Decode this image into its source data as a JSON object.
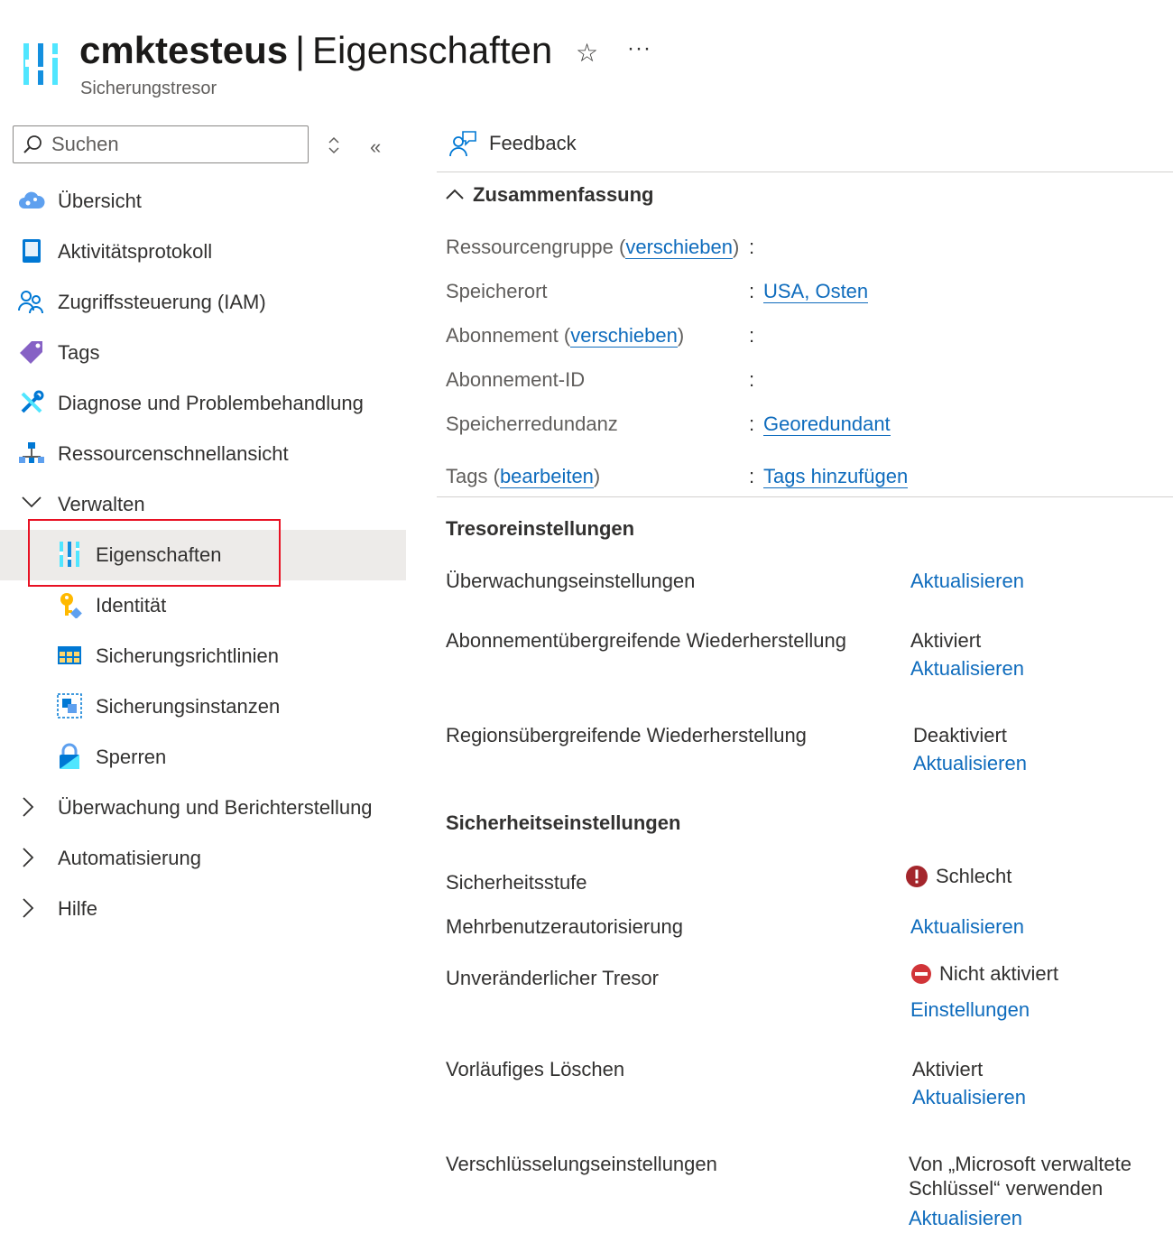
{
  "header": {
    "resource_name": "cmktesteus",
    "separator": "|",
    "page_title": "Eigenschaften",
    "subtitle": "Sicherungstresor",
    "favorite_icon": "star-icon",
    "more_label": "···"
  },
  "sidebar": {
    "search_placeholder": "Suchen",
    "items": [
      {
        "label": "Übersicht",
        "icon": "cloud-overview-icon"
      },
      {
        "label": "Aktivitätsprotokoll",
        "icon": "activity-log-icon"
      },
      {
        "label": "Zugriffssteuerung (IAM)",
        "icon": "people-icon"
      },
      {
        "label": "Tags",
        "icon": "tag-icon"
      },
      {
        "label": "Diagnose und Problembehandlung",
        "icon": "wrench-icon"
      },
      {
        "label": "Ressourcenschnellansicht",
        "icon": "hierarchy-icon"
      },
      {
        "label": "Verwalten",
        "expanded": true
      },
      {
        "label": "Eigenschaften",
        "icon": "properties-icon",
        "selected": true
      },
      {
        "label": "Identität",
        "icon": "key-icon"
      },
      {
        "label": "Sicherungsrichtlinien",
        "icon": "table-icon"
      },
      {
        "label": "Sicherungsinstanzen",
        "icon": "instances-icon"
      },
      {
        "label": "Sperren",
        "icon": "lock-icon"
      },
      {
        "label": "Überwachung und Berichterstellung",
        "expanded": false
      },
      {
        "label": "Automatisierung",
        "expanded": false
      },
      {
        "label": "Hilfe",
        "expanded": false
      }
    ]
  },
  "toolbar": {
    "feedback_label": "Feedback"
  },
  "summary": {
    "title": "Zusammenfassung",
    "rows": {
      "resource_group": {
        "label": "Ressourcengruppe",
        "action": "verschieben",
        "value": ""
      },
      "location": {
        "label": "Speicherort",
        "value": "USA, Osten"
      },
      "subscription": {
        "label": "Abonnement",
        "action": "verschieben",
        "value": ""
      },
      "subscription_id": {
        "label": "Abonnement-ID",
        "value": ""
      },
      "redundancy": {
        "label": "Speicherredundanz",
        "value": "Georedundant"
      },
      "tags": {
        "label": "Tags",
        "action": "bearbeiten",
        "value": "Tags hinzufügen"
      }
    }
  },
  "vault_settings": {
    "title": "Tresoreinstellungen",
    "monitoring": {
      "label": "Überwachungseinstellungen",
      "action": "Aktualisieren"
    },
    "cross_sub_restore": {
      "label": "Abonnementübergreifende Wiederherstellung",
      "status": "Aktiviert",
      "action": "Aktualisieren"
    },
    "cross_region_restore": {
      "label": "Regionsübergreifende Wiederherstellung",
      "status": "Deaktiviert",
      "action": "Aktualisieren"
    }
  },
  "security_settings": {
    "title": "Sicherheitseinstellungen",
    "security_level": {
      "label": "Sicherheitsstufe",
      "status": "Schlecht",
      "status_color": "#a4262c"
    },
    "mua": {
      "label": "Mehrbenutzerautorisierung",
      "action": "Aktualisieren"
    },
    "immutable": {
      "label": "Unveränderlicher Tresor",
      "status": "Nicht aktiviert",
      "status_color": "#d13438",
      "action": "Einstellungen"
    },
    "soft_delete": {
      "label": "Vorläufiges Löschen",
      "status": "Aktiviert",
      "action": "Aktualisieren"
    },
    "encryption": {
      "label": "Verschlüsselungseinstellungen",
      "status_line1": "Von „Microsoft verwaltete",
      "status_line2": "Schlüssel“ verwenden",
      "action": "Aktualisieren"
    }
  },
  "colors": {
    "link": "#0f6cbd",
    "selected_bg": "#edebe9",
    "highlight_border": "#e81123"
  }
}
